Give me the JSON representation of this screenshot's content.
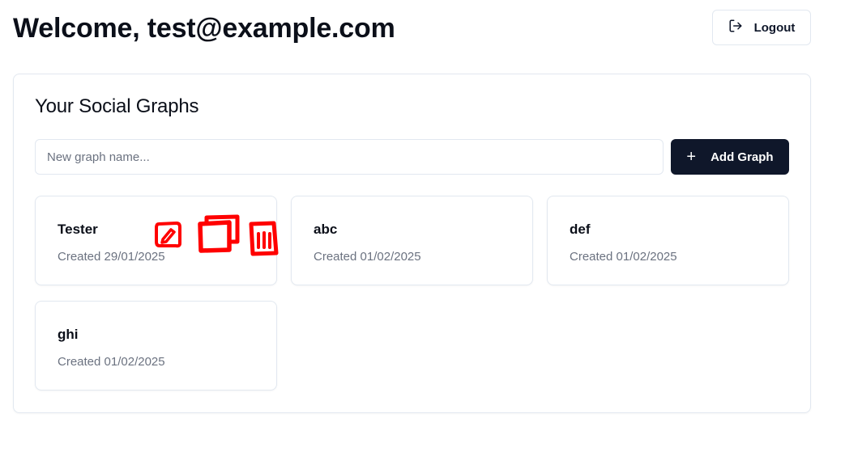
{
  "header": {
    "title": "Welcome, test@example.com",
    "logout_label": "Logout"
  },
  "main": {
    "title": "Your Social Graphs",
    "new_graph_placeholder": "New graph name...",
    "add_graph_label": "Add Graph",
    "graphs": [
      {
        "name": "Tester",
        "created": "Created 29/01/2025"
      },
      {
        "name": "abc",
        "created": "Created 01/02/2025"
      },
      {
        "name": "def",
        "created": "Created 01/02/2025"
      },
      {
        "name": "ghi",
        "created": "Created 01/02/2025"
      }
    ]
  },
  "colors": {
    "primary_button": "#0f172a",
    "annotation": "#ff0000"
  },
  "icons": [
    "logout-icon",
    "plus-icon",
    "edit-icon",
    "copy-icon",
    "delete-icon"
  ]
}
